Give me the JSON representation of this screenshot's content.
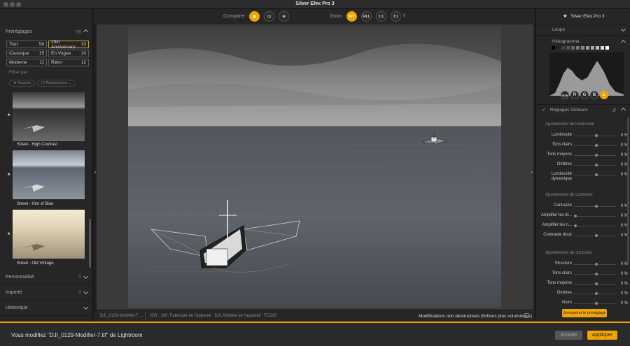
{
  "window": {
    "title": "Silver Efex Pro 3"
  },
  "toolbar": {
    "compare_label": "Comparer",
    "zoom_label": "Zoom",
    "zoom_fit": "FIT",
    "zoom_fill": "FILL",
    "zoom_11": "1:1",
    "zoom_31": "3:1",
    "accent": "#f0a500"
  },
  "presets": {
    "header": "Préréglages",
    "count": "58",
    "categories": [
      {
        "label": "Tout",
        "count": "58"
      },
      {
        "label": "25th Anniversary",
        "count": "10"
      },
      {
        "label": "Classique",
        "count": "15"
      },
      {
        "label": "En Vogue",
        "count": "10"
      },
      {
        "label": "Moderne",
        "count": "11"
      },
      {
        "label": "Rétro",
        "count": "12"
      }
    ],
    "filter_label": "Filtrer par :",
    "filter_favorites": "Favoris",
    "filter_recent": "Récemment ...",
    "thumbs": [
      {
        "label": "Street - High Contrast",
        "star": "★"
      },
      {
        "label": "Street - Hint of Blue",
        "star": "★"
      },
      {
        "label": "Street - Old Vintage",
        "star": "★"
      }
    ]
  },
  "leftsections": [
    {
      "label": "Personnalisé",
      "count": "0"
    },
    {
      "label": "Importé",
      "count": "0"
    },
    {
      "label": "Historique",
      "count": ""
    }
  ],
  "status": {
    "filename": "DJI_0129-Modifier-7....",
    "meta": "ISO : 100, Fabricant de l'appareil : DJI, Modèle de l'appareil : FC220",
    "nondestructive": "Modifications non destructives (fichiers plus volumineux)"
  },
  "right": {
    "brand": "Silver Efex Pro 3",
    "loupe": "Loupe",
    "histogram": "Histogramme",
    "channels": [
      "RGB",
      "R",
      "G",
      "B",
      "L"
    ],
    "global": "Réglages Globaux",
    "groups": [
      {
        "label": "Ajustements de luminosité",
        "rows": [
          {
            "label": "Luminosité",
            "value": "0 %"
          },
          {
            "label": "Tons clairs",
            "value": "0 %"
          },
          {
            "label": "Tons moyens",
            "value": "0 %"
          },
          {
            "label": "Ombres",
            "value": "0 %"
          },
          {
            "label": "Luminosité dynamique",
            "value": "0 %"
          }
        ]
      },
      {
        "label": "Ajustements de contraste",
        "rows": [
          {
            "label": "Contraste",
            "value": "0 %"
          },
          {
            "label": "Amplifier les bl...",
            "value": "0 %"
          },
          {
            "label": "Amplifier les n...",
            "value": "0 %"
          },
          {
            "label": "Contraste doux",
            "value": "0 %"
          }
        ]
      },
      {
        "label": "Ajustements de structure",
        "rows": [
          {
            "label": "Structure",
            "value": "0 %"
          },
          {
            "label": "Tons clairs",
            "value": "0 %"
          },
          {
            "label": "Tons moyens",
            "value": "0 %"
          },
          {
            "label": "Ombres",
            "value": "0 %"
          },
          {
            "label": "Noirs",
            "value": "0 %"
          },
          {
            "label": "Structure fine",
            "value": ""
          }
        ]
      }
    ],
    "save_preset": "Enregistrer le préréglage"
  },
  "footer": {
    "message": "Vous modifiez \"DJI_0129-Modifier-7.tif\" de Lightroom",
    "cancel": "Annuler",
    "apply": "Appliquer"
  }
}
